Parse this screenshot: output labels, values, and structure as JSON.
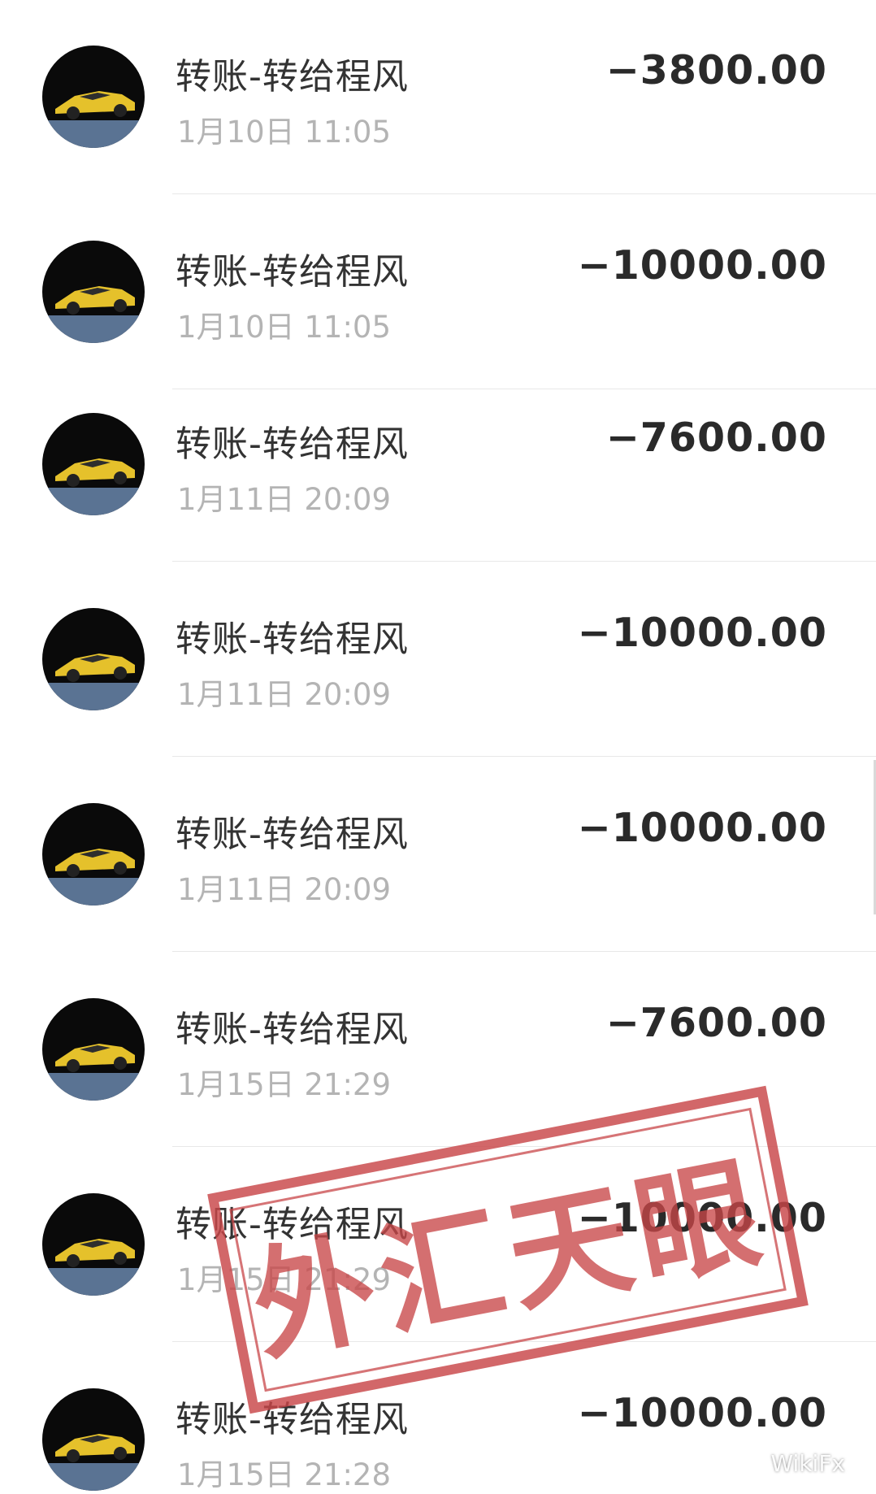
{
  "transactions": [
    {
      "title": "转账-转给程风",
      "time": "1月10日 11:05",
      "amount": "−3800.00"
    },
    {
      "title": "转账-转给程风",
      "time": "1月10日 11:05",
      "amount": "−10000.00"
    },
    {
      "title": "转账-转给程风",
      "time": "1月11日 20:09",
      "amount": "−7600.00"
    },
    {
      "title": "转账-转给程风",
      "time": "1月11日 20:09",
      "amount": "−10000.00"
    },
    {
      "title": "转账-转给程风",
      "time": "1月11日 20:09",
      "amount": "−10000.00"
    },
    {
      "title": "转账-转给程风",
      "time": "1月15日 21:29",
      "amount": "−7600.00"
    },
    {
      "title": "转账-转给程风",
      "time": "1月15日 21:29",
      "amount": "−10000.00"
    },
    {
      "title": "转账-转给程风",
      "time": "1月15日 21:28",
      "amount": "−10000.00"
    }
  ],
  "avatar_icon": "sports-car-icon",
  "stamp": {
    "text": "外汇天眼",
    "color": "#c84648"
  },
  "watermark": {
    "text": "WikiFx",
    "icon": "wechat-icon"
  },
  "colors": {
    "title": "#333333",
    "time": "#b4b4b4",
    "amount": "#2a2a2a",
    "divider": "#e8e8e8"
  }
}
